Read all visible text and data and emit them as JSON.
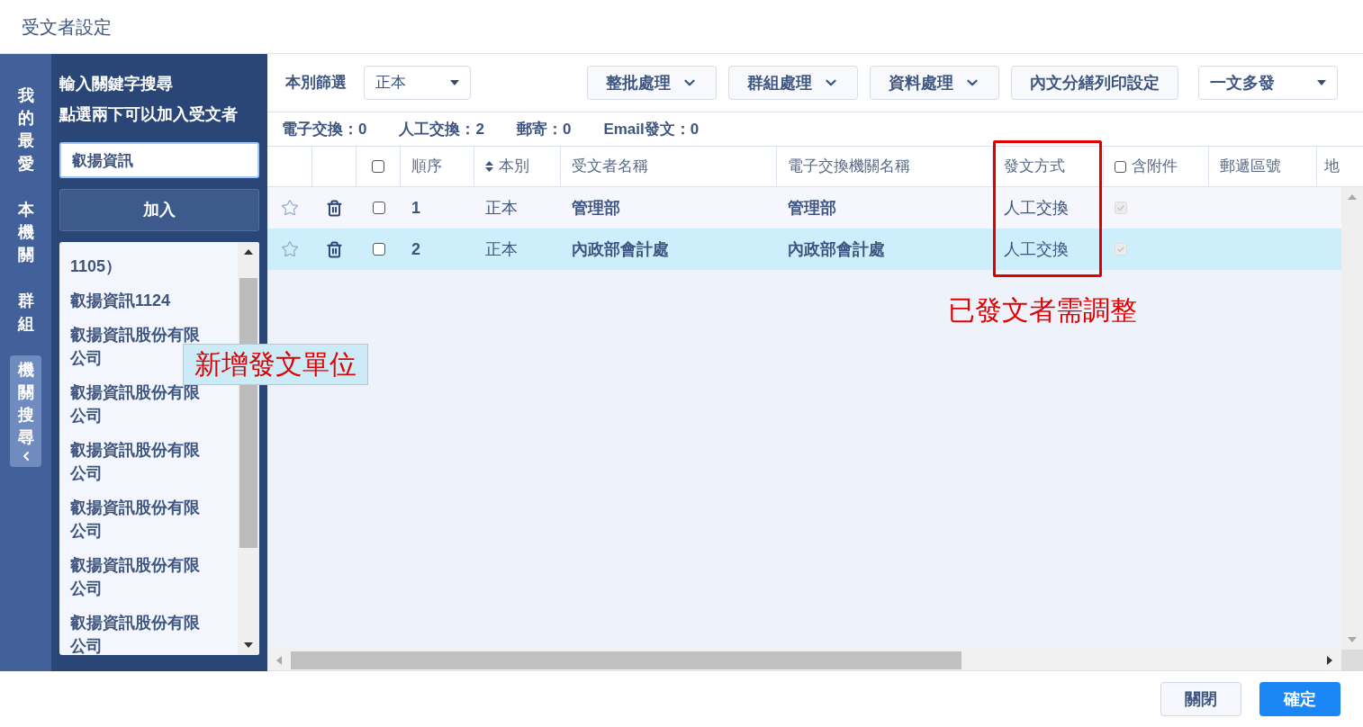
{
  "window": {
    "title": "受文者設定"
  },
  "rail_tabs": [
    {
      "label": "我的最愛",
      "selected": false
    },
    {
      "label": "本機關",
      "selected": false
    },
    {
      "label": "群組",
      "selected": false
    },
    {
      "label": "機關搜尋",
      "selected": true
    }
  ],
  "search_panel": {
    "hint_lines": [
      "輸入關鍵字搜尋",
      "點選兩下可以加入受文者"
    ],
    "search_value": "叡揚資訊",
    "add_button": "加入",
    "results": [
      "1105）",
      "叡揚資訊1124",
      "叡揚資訊股份有限公司",
      "叡揚資訊股份有限公司",
      "叡揚資訊股份有限公司",
      "叡揚資訊股份有限公司",
      "叡揚資訊股份有限公司",
      "叡揚資訊股份有限公司"
    ]
  },
  "toolbar": {
    "filter_label": "本別篩選",
    "filter_value": "正本",
    "menu_buttons": [
      {
        "label": "整批處理",
        "kind": "menu"
      },
      {
        "label": "群組處理",
        "kind": "menu"
      },
      {
        "label": "資料處理",
        "kind": "menu"
      },
      {
        "label": "內文分繕列印設定",
        "kind": "plain"
      }
    ],
    "mode_value": "一文多發"
  },
  "counts": [
    "電子交換：0",
    "人工交換：2",
    "郵寄：0",
    "Email發文：0"
  ],
  "table": {
    "select_all_checked": false,
    "attachment_all_checked": false,
    "columns": [
      "順序",
      "本別",
      "受文者名稱",
      "電子交換機關名稱",
      "發文方式",
      "含附件",
      "郵遞區號",
      "地"
    ],
    "rows": [
      {
        "favorite": false,
        "checked": false,
        "selected": false,
        "order": "1",
        "copy_type": "正本",
        "name": "管理部",
        "exchange_name": "管理部",
        "method": "人工交換",
        "attachment": true
      },
      {
        "favorite": false,
        "checked": false,
        "selected": true,
        "order": "2",
        "copy_type": "正本",
        "name": "內政部會計處",
        "exchange_name": "內政部會計處",
        "method": "人工交換",
        "attachment": true
      }
    ]
  },
  "annotations": {
    "add_note": "新增發文單位",
    "adjust_note": "已發文者需調整"
  },
  "footer": {
    "buttons": [
      {
        "label": "關閉",
        "kind": "secondary"
      },
      {
        "label": "確定",
        "kind": "primary"
      }
    ]
  }
}
